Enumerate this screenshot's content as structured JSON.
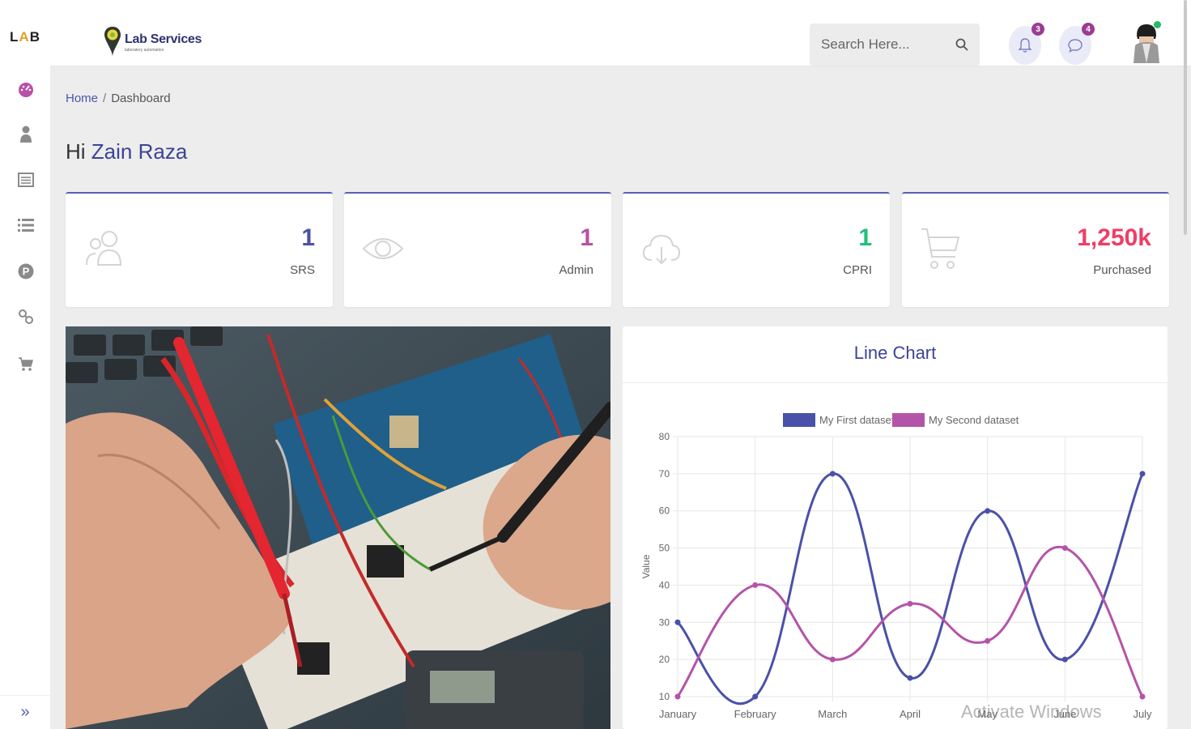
{
  "rail": {
    "logo_l": "L",
    "logo_a": "A",
    "logo_b": "B",
    "items": [
      "dashboard-icon",
      "user-icon",
      "list-box-icon",
      "list-icon",
      "parking-icon",
      "link-icon",
      "cart-icon"
    ],
    "expand": "»"
  },
  "topbar": {
    "brand_name": "Lab Services",
    "brand_sub": "laboratory automation",
    "search_placeholder": "Search Here...",
    "notifications_count": "3",
    "messages_count": "4"
  },
  "breadcrumb": {
    "home": "Home",
    "sep": "/",
    "current": "Dashboard"
  },
  "greeting": {
    "prefix": "Hi",
    "name": "Zain Raza"
  },
  "stats": [
    {
      "value": "1",
      "label": "SRS",
      "color": "#4a51a8",
      "icon": "users-icon"
    },
    {
      "value": "1",
      "label": "Admin",
      "color": "#b94fa8",
      "icon": "eye-icon"
    },
    {
      "value": "1",
      "label": "CPRI",
      "color": "#1fc07a",
      "icon": "cloud-download-icon"
    },
    {
      "value": "1,250k",
      "label": "Purchased",
      "color": "#ee3e66",
      "icon": "cart-icon"
    }
  ],
  "chart_panel": {
    "title": "Line Chart"
  },
  "chart_data": {
    "type": "line",
    "categories": [
      "January",
      "February",
      "March",
      "April",
      "May",
      "June",
      "July"
    ],
    "series": [
      {
        "name": "My First dataset",
        "values": [
          30,
          10,
          70,
          15,
          60,
          20,
          70
        ],
        "color": "#4a51a8"
      },
      {
        "name": "My Second dataset",
        "values": [
          10,
          40,
          20,
          35,
          25,
          50,
          10
        ],
        "color": "#b454a8"
      }
    ],
    "xlabel": "",
    "ylabel": "Value",
    "ylim": [
      10,
      80
    ],
    "yticks": [
      10,
      20,
      30,
      40,
      50,
      60,
      70,
      80
    ],
    "grid": true,
    "legend": "top"
  },
  "watermark": "Activate Windows"
}
